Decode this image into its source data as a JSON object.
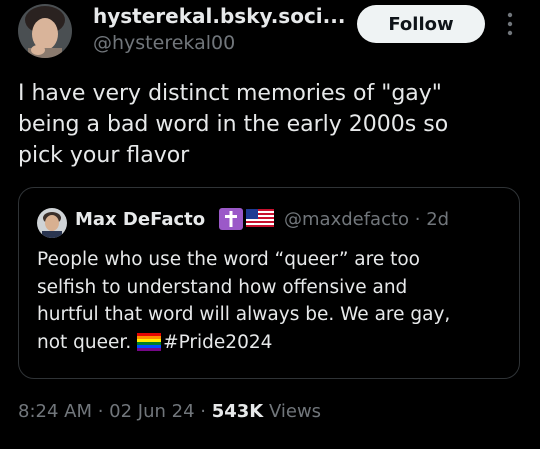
{
  "author": {
    "display_name": "hysterekal.bsky.soci...",
    "handle": "@hysterekal00",
    "avatar_icon": "user-avatar"
  },
  "follow_label": "Follow",
  "more_icon": "more-vertical-icon",
  "tweet": {
    "lines": [
      "I have very distinct memories of \"gay\"",
      "being a bad word in the early 2000s so",
      "pick your flavor"
    ]
  },
  "quote": {
    "display_name": "Max DeFacto",
    "badges": [
      "cross-emoji",
      "us-flag-emoji"
    ],
    "handle": "@maxdefacto · 2d",
    "lines": [
      "People who use the word “queer” are too",
      "selfish to understand how offensive and",
      "hurtful that word will always be. We are gay,"
    ],
    "last_line_prefix": "not queer.",
    "last_line_emoji": "rainbow-flag-emoji",
    "hashtag": "#Pride2024"
  },
  "meta": {
    "time_date": "8:24 AM · 02 Jun 24 · ",
    "views_count": "543K",
    "views_label": " Views"
  },
  "colors": {
    "background": "#000000",
    "text": "#e7e9ea",
    "secondary": "#71767b",
    "border": "#2f3336",
    "button_bg": "#eff3f4",
    "badge_purple": "#9b59c8"
  }
}
